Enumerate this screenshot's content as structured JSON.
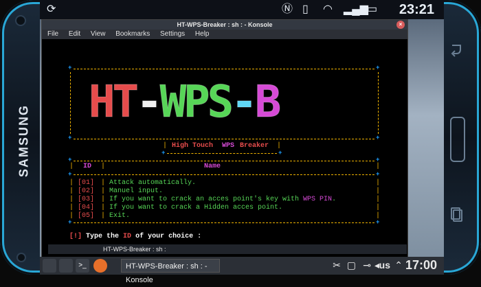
{
  "device": {
    "brand": "SAMSUNG",
    "status_time": "23:21"
  },
  "window": {
    "title": "HT-WPS-Breaker : sh : - Konsole",
    "menu": [
      "File",
      "Edit",
      "View",
      "Bookmarks",
      "Settings",
      "Help"
    ]
  },
  "terminal": {
    "logo": {
      "parts": [
        "H",
        "T",
        "-",
        "W",
        "P",
        "S",
        "-",
        "B"
      ],
      "colors": [
        "#e64c4c",
        "#e64c4c",
        "#ffffff",
        "#57d657",
        "#57d657",
        "#57d657",
        "#5fd7f5",
        "#d64ad6"
      ]
    },
    "subtitle": {
      "bar_left": "|",
      "high_touch": "High Touch",
      "wps": "WPS",
      "breaker": "Breaker",
      "bar_right": "|"
    },
    "table": {
      "header_id": "ID",
      "header_name": "Name",
      "rows": [
        {
          "id": "[01]",
          "name": "Attack automatically."
        },
        {
          "id": "[02]",
          "name": "Manuel input."
        },
        {
          "id": "[03]",
          "name_prefix": "If you want to crack an acces point's key with ",
          "name_hl": "WPS PIN",
          "name_suffix": "."
        },
        {
          "id": "[04]",
          "name": "If you want to crack a Hidden acces point."
        },
        {
          "id": "[05]",
          "name": "Exit."
        }
      ]
    },
    "prompt": {
      "mark": "[!]",
      "pre": "Type the ",
      "id": "ID",
      "post": " of your choice :"
    }
  },
  "minimized_strip": {
    "label": "HT-WPS-Breaker : sh :"
  },
  "taskbar": {
    "task_label": "HT-WPS-Breaker : sh : - Konsole",
    "locale": "us",
    "time": "17:00"
  },
  "colors": {
    "frame": "#f1b400",
    "corner": "#1ea0ff",
    "prompt_red": "#e64c4c",
    "menu_green": "#57d657",
    "magenta": "#d64ad6"
  }
}
